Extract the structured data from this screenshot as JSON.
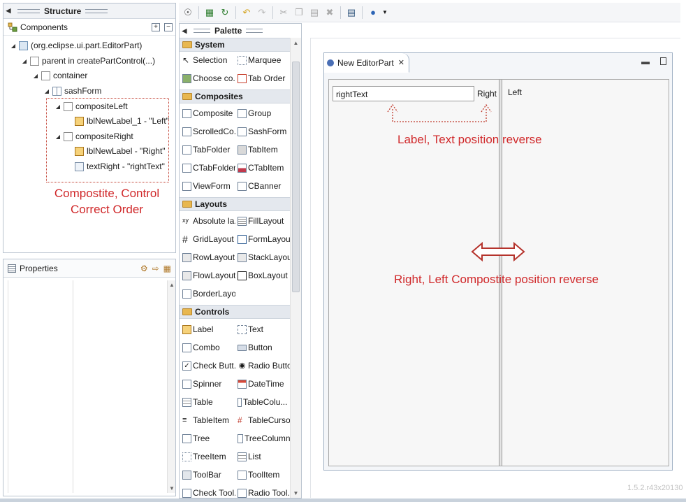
{
  "structure": {
    "title": "Structure",
    "components_label": "Components",
    "tree": [
      {
        "label": "(org.eclipse.ui.part.EditorPart)",
        "icon": "editorpart-icon"
      },
      {
        "label": "parent in createPartControl(...)",
        "icon": "composite-icon"
      },
      {
        "label": "container",
        "icon": "composite-icon"
      },
      {
        "label": "sashForm",
        "icon": "sashform-icon"
      },
      {
        "label": "compositeLeft",
        "icon": "composite-icon"
      },
      {
        "label": "lblNewLabel_1 - \"Left\"",
        "icon": "label-icon"
      },
      {
        "label": "compositeRight",
        "icon": "composite-icon"
      },
      {
        "label": "lblNewLabel - \"Right\"",
        "icon": "label-icon"
      },
      {
        "label": "textRight - \"rightText\"",
        "icon": "text-icon"
      }
    ],
    "annotation_line1": "Compostite, Control",
    "annotation_line2": "Correct Order"
  },
  "properties": {
    "title": "Properties"
  },
  "palette": {
    "title": "Palette",
    "categories": [
      {
        "name": "System",
        "items": [
          "Selection",
          "Marquee",
          "Choose co...",
          "Tab Order"
        ]
      },
      {
        "name": "Composites",
        "items": [
          "Composite",
          "Group",
          "ScrolledCo...",
          "SashForm",
          "TabFolder",
          "TabItem",
          "CTabFolder",
          "CTabItem",
          "ViewForm",
          "CBanner"
        ]
      },
      {
        "name": "Layouts",
        "items": [
          "Absolute la...",
          "FillLayout",
          "GridLayout",
          "FormLayout",
          "RowLayout",
          "StackLayout",
          "FlowLayout",
          "BoxLayout",
          "BorderLayo..."
        ]
      },
      {
        "name": "Controls",
        "items": [
          "Label",
          "Text",
          "Combo",
          "Button",
          "Check Butt...",
          "Radio Button",
          "Spinner",
          "DateTime",
          "Table",
          "TableColu...",
          "TableItem",
          "TableCursor",
          "Tree",
          "TreeColumn",
          "TreeItem",
          "List",
          "ToolBar",
          "ToolItem",
          "Check Tool...",
          "Radio Tool..."
        ]
      }
    ]
  },
  "editor": {
    "tab_title": "New EditorPart",
    "text_value": "rightText",
    "label_right": "Right",
    "label_left": "Left",
    "annotation_top": "Label, Text position reverse",
    "annotation_bottom": "Right, Left Compostite position reverse"
  },
  "version": "1.5.2.r43x20130",
  "colors": {
    "annotation_red": "#d0282a",
    "arrow_red": "#b5332c"
  }
}
